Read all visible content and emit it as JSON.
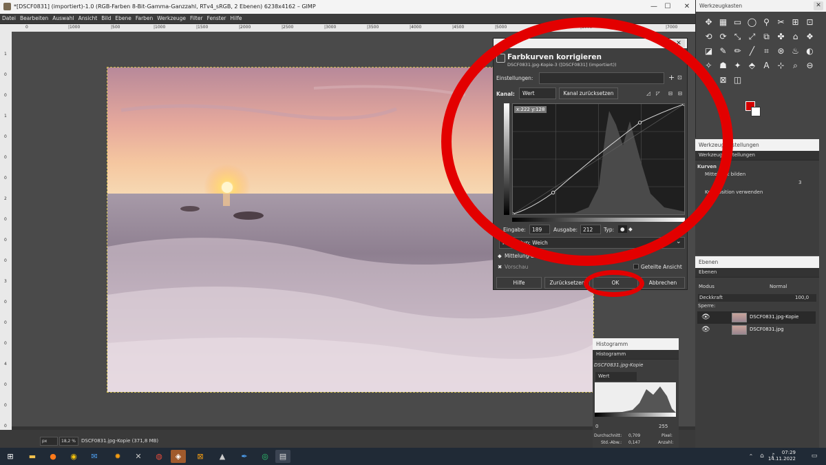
{
  "window": {
    "title": "*[DSCF0831] (importiert)-1.0 (RGB-Farben 8-Bit-Gamma-Ganzzahl, RTv4_sRGB, 2 Ebenen) 6238x4162 – GIMP",
    "minimize": "—",
    "maximize": "☐",
    "close": "✕"
  },
  "menu": [
    "Datei",
    "Bearbeiten",
    "Auswahl",
    "Ansicht",
    "Bild",
    "Ebene",
    "Farben",
    "Werkzeuge",
    "Filter",
    "Fenster",
    "Hilfe"
  ],
  "ruler": {
    "top_ticks": [
      "0",
      "|1000",
      "|500",
      "|1000",
      "|1500",
      "|2000",
      "|2500",
      "|3000",
      "|3500",
      "|4000",
      "|4500",
      "|5000",
      "|5500",
      "|6000",
      "|6500",
      "|7000"
    ],
    "left_ticks": [
      "1",
      "0",
      "0",
      "1",
      "0",
      "0",
      "0",
      "2",
      "0",
      "0",
      "0",
      "3",
      "0",
      "0",
      "0",
      "4",
      "0",
      "0",
      "0"
    ]
  },
  "statusbar": {
    "unit": "px",
    "zoom": "18,2 %",
    "file_info": "DSCF0831.jpg-Kopie (371,8 MB)"
  },
  "curves_dialog": {
    "title": "Farbkurven korrigieren",
    "subtitle": "DSCF0831.jpg-Kopie-3 ([DSCF0831] (importiert))",
    "settings_label": "Einstellungen:",
    "settings_value": "",
    "channel_label": "Kanal:",
    "channel_value": "Wert",
    "reset_channel": "Kanal zurücksetzen",
    "coord_tooltip": "x:222 y:128",
    "input_label": "Eingabe:",
    "input_value": "189",
    "output_label": "Ausgabe:",
    "output_value": "212",
    "type_label": "Typ:",
    "curve_type": "Kurventyp: Weich",
    "averaging": "Mittelung-Einstellungen",
    "preview": "Vorschau",
    "split_view": "Geteilte Ansicht",
    "buttons": {
      "help": "Hilfe",
      "reset": "Zurücksetzen",
      "ok": "OK",
      "cancel": "Abbrechen"
    },
    "curve_points": [
      [
        0,
        0
      ],
      [
        60,
        50
      ],
      [
        189,
        212
      ],
      [
        255,
        255
      ]
    ]
  },
  "toolbox": {
    "title": "Werkzeugkasten",
    "tools": [
      "✥",
      "▦",
      "▭",
      "◯",
      "⚲",
      "✂",
      "⊞",
      "⊡",
      "⟲",
      "⟳",
      "⤡",
      "⤢",
      "⧉",
      "✤",
      "⌂",
      "❖",
      "◪",
      "✎",
      "✏",
      "╱",
      "⌗",
      "⊛",
      "♨",
      "◐",
      "✧",
      "☗",
      "✦",
      "⬘",
      "A",
      "⊹",
      "⌕",
      "⊖",
      "✚",
      "⊠",
      "◫"
    ],
    "fg_color": "#d30000",
    "bg_color": "#ffffff"
  },
  "tool_options": {
    "title": "Werkzeugeinstellungen",
    "tab": "Werkzeugeinstellungen",
    "section": "Kurven",
    "opt1": "Mittelwert bilden",
    "opt1_value": "3",
    "opt2": "Komposition verwenden"
  },
  "layers": {
    "title": "Ebenen",
    "tab": "Ebenen",
    "mode_label": "Modus",
    "mode_value": "Normal",
    "opacity_label": "Deckkraft",
    "opacity_value": "100,0",
    "lock_label": "Sperre:",
    "items": [
      {
        "name": "DSCF0831.jpg-Kopie",
        "selected": true
      },
      {
        "name": "DSCF0831.jpg",
        "selected": false
      }
    ]
  },
  "histogram": {
    "title": "Histogramm",
    "tab": "Histogramm",
    "source": "DSCF0831.jpg-Kopie",
    "channel": "Wert",
    "range_min": "0",
    "range_max": "255",
    "mean_label": "Durchschnitt:",
    "mean_value": "0,709",
    "std_label": "Std.-Abw.:",
    "std_value": "0,147",
    "pixels_label": "Pixel:",
    "count_label": "Anzahl:"
  },
  "taskbar": {
    "time": "07:29",
    "date": "14.11.2022"
  },
  "colors": {
    "annotation": "#e30000",
    "fg": "#d30000"
  }
}
